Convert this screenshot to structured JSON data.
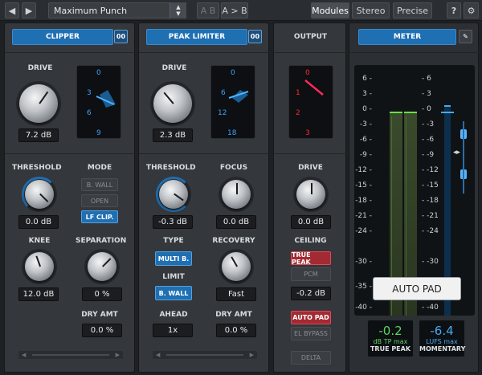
{
  "topbar": {
    "back_icon": "arrow-left",
    "forward_icon": "arrow-right",
    "preset_name": "Maximum Punch",
    "ab_compare": "A B",
    "ab_copy": "A > B",
    "tabs": [
      "Modules",
      "Stereo",
      "Precise"
    ],
    "help": "?",
    "settings_icon": "gear"
  },
  "clipper": {
    "title": "CLIPPER",
    "link": "00",
    "drive_label": "DRIVE",
    "drive_value": "7.2 dB",
    "scope_ticks": [
      "0",
      "3",
      "6",
      "9"
    ],
    "threshold_label": "THRESHOLD",
    "threshold_value": "0.0 dB",
    "mode_label": "MODE",
    "mode_options": [
      "B. WALL",
      "OPEN",
      "LF CLIP."
    ],
    "knee_label": "KNEE",
    "knee_value": "12.0 dB",
    "separation_label": "SEPARATION",
    "separation_value": "0 %",
    "dry_label": "DRY AMT",
    "dry_value": "0.0 %"
  },
  "limiter": {
    "title": "PEAK LIMITER",
    "link": "00",
    "drive_label": "DRIVE",
    "drive_value": "2.3 dB",
    "scope_ticks": [
      "0",
      "6",
      "12",
      "18"
    ],
    "threshold_label": "THRESHOLD",
    "threshold_value": "-0.3 dB",
    "focus_label": "FOCUS",
    "focus_value": "0.0 dB",
    "type_label": "TYPE",
    "type_value": "MULTI B.",
    "recovery_label": "RECOVERY",
    "recovery_value": "Fast",
    "limit_label": "LIMIT",
    "limit_value": "B. WALL",
    "ahead_label": "AHEAD",
    "ahead_value": "1x",
    "dry_label": "DRY AMT",
    "dry_value": "0.0 %"
  },
  "output": {
    "title": "OUTPUT",
    "scope_ticks": [
      "0",
      "1",
      "2",
      "3"
    ],
    "drive_label": "DRIVE",
    "drive_value": "0.0 dB",
    "ceiling_label": "CEILING",
    "ceiling_options": [
      "TRUE PEAK",
      "PCM"
    ],
    "ceiling_value": "-0.2 dB",
    "auto_pad": "AUTO PAD",
    "el_bypass": "EL BYPASS",
    "delta": "DELTA"
  },
  "meter": {
    "title": "METER",
    "wrench_icon": "wrench",
    "left_scale": [
      "6",
      "3",
      "0",
      "-3",
      "-6",
      "-9",
      "-12",
      "-15",
      "-18",
      "-21",
      "-24",
      "-30",
      "-35",
      "-40"
    ],
    "right_scale": [
      "6",
      "3",
      "0",
      "-3",
      "-6",
      "-9",
      "-12",
      "-15",
      "-18",
      "-21",
      "-24",
      "-30",
      "-35",
      "-40"
    ],
    "auto_pad_overlay": "AUTO PAD",
    "tp_value": "-0.2",
    "tp_unit": "dB TP max",
    "tp_label": "TRUE PEAK",
    "lufs_value": "-6.4",
    "lufs_unit": "LUFS max",
    "lufs_label": "MOMENTARY",
    "colors": {
      "accent": "#1f6fb3",
      "green": "#5fd35f",
      "blue": "#4aa8f0"
    }
  }
}
